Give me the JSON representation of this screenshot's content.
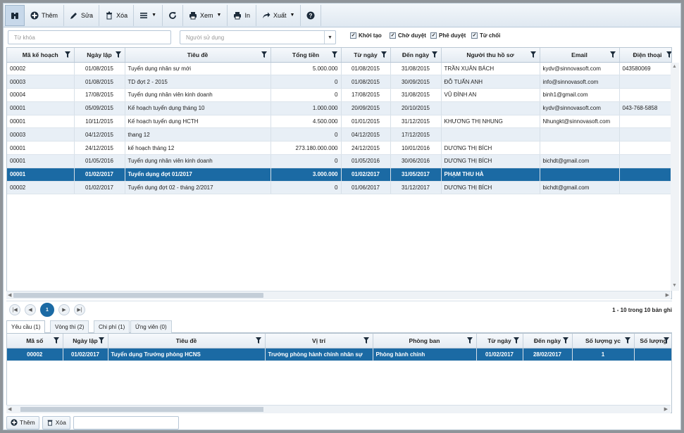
{
  "toolbar": {
    "search_icon": "binoculars-icon",
    "add_label": "Thêm",
    "edit_label": "Sửa",
    "delete_label": "Xóa",
    "view_label": "Xem",
    "print_label": "In",
    "export_label": "Xuất"
  },
  "filters": {
    "keyword_placeholder": "Từ khóa",
    "user_placeholder": "Người sử dụng",
    "status": [
      {
        "label": "Khởi tạo",
        "checked": true
      },
      {
        "label": "Chờ duyệt",
        "checked": true
      },
      {
        "label": "Phê duyệt",
        "checked": true
      },
      {
        "label": "Từ chối",
        "checked": true
      }
    ]
  },
  "main_grid": {
    "columns": [
      "Mã kế hoạch",
      "Ngày lập",
      "Tiêu đề",
      "Tổng tiền",
      "Từ ngày",
      "Đến ngày",
      "Người thu hồ sơ",
      "Email",
      "Điện thoại"
    ],
    "rows": [
      [
        "00002",
        "01/08/2015",
        "Tuyển dụng nhân sự mới",
        "5.000.000",
        "01/08/2015",
        "31/08/2015",
        "TRẦN XUÂN BÁCH",
        "kydv@sinnovasoft.com",
        "043580069"
      ],
      [
        "00003",
        "01/08/2015",
        "TD đợt 2 - 2015",
        "0",
        "01/08/2015",
        "30/09/2015",
        "ĐỖ TUẤN ANH",
        "info@sinnovasoft.com",
        ""
      ],
      [
        "00004",
        "17/08/2015",
        "Tuyển dụng nhân viên kinh doanh",
        "0",
        "17/08/2015",
        "31/08/2015",
        "VŨ ĐÌNH AN",
        "binh1@gmail.com",
        ""
      ],
      [
        "00001",
        "05/09/2015",
        "Kế hoạch tuyển dụng tháng 10",
        "1.000.000",
        "20/09/2015",
        "20/10/2015",
        "",
        "kydv@sinnovasoft.com",
        "043-768-5858"
      ],
      [
        "00001",
        "10/11/2015",
        "Kế hoạch tuyển dụng HCTH",
        "4.500.000",
        "01/01/2015",
        "31/12/2015",
        "KHƯƠNG THỊ NHUNG",
        "Nhungkt@sinnovasoft.com",
        ""
      ],
      [
        "00003",
        "04/12/2015",
        "thang 12",
        "0",
        "04/12/2015",
        "17/12/2015",
        "",
        "",
        ""
      ],
      [
        "00001",
        "24/12/2015",
        "kế hoạch tháng 12",
        "273.180.000.000",
        "24/12/2015",
        "10/01/2016",
        "DƯƠNG THỊ BÍCH",
        "",
        ""
      ],
      [
        "00001",
        "01/05/2016",
        "Tuyển dụng nhân viên kinh doanh",
        "0",
        "01/05/2016",
        "30/06/2016",
        "DƯƠNG THỊ BÍCH",
        "bichdt@gmail.com",
        ""
      ],
      [
        "00001",
        "01/02/2017",
        "Tuyển dụng đợt 01/2017",
        "3.000.000",
        "01/02/2017",
        "31/05/2017",
        "PHẠM THU HÀ",
        "",
        ""
      ],
      [
        "00002",
        "01/02/2017",
        "Tuyển dụng đợt 02 - tháng 2/2017",
        "0",
        "01/06/2017",
        "31/12/2017",
        "DƯƠNG THỊ BÍCH",
        "bichdt@gmail.com",
        ""
      ]
    ],
    "selected_index": 8
  },
  "pager": {
    "current": "1",
    "info": "1 - 10 trong 10 bản ghi"
  },
  "detail_tabs": [
    "Yêu cầu (1)",
    "Vòng thi (2)",
    "Chi phí (1)",
    "Ứng viên (0)"
  ],
  "detail_grid": {
    "columns": [
      "Mã số",
      "Ngày lập",
      "Tiêu đề",
      "Vị trí",
      "Phòng ban",
      "Từ ngày",
      "Đến ngày",
      "Số lượng yc",
      "Số lượng"
    ],
    "rows": [
      [
        "00002",
        "01/02/2017",
        "Tuyển dụng Trưởng phòng HCNS",
        "Trưởng phòng hành chính nhân sự",
        "Phòng hành chính",
        "01/02/2017",
        "28/02/2017",
        "1",
        ""
      ]
    ]
  },
  "bottom": {
    "add_label": "Thêm",
    "delete_label": "Xóa"
  }
}
